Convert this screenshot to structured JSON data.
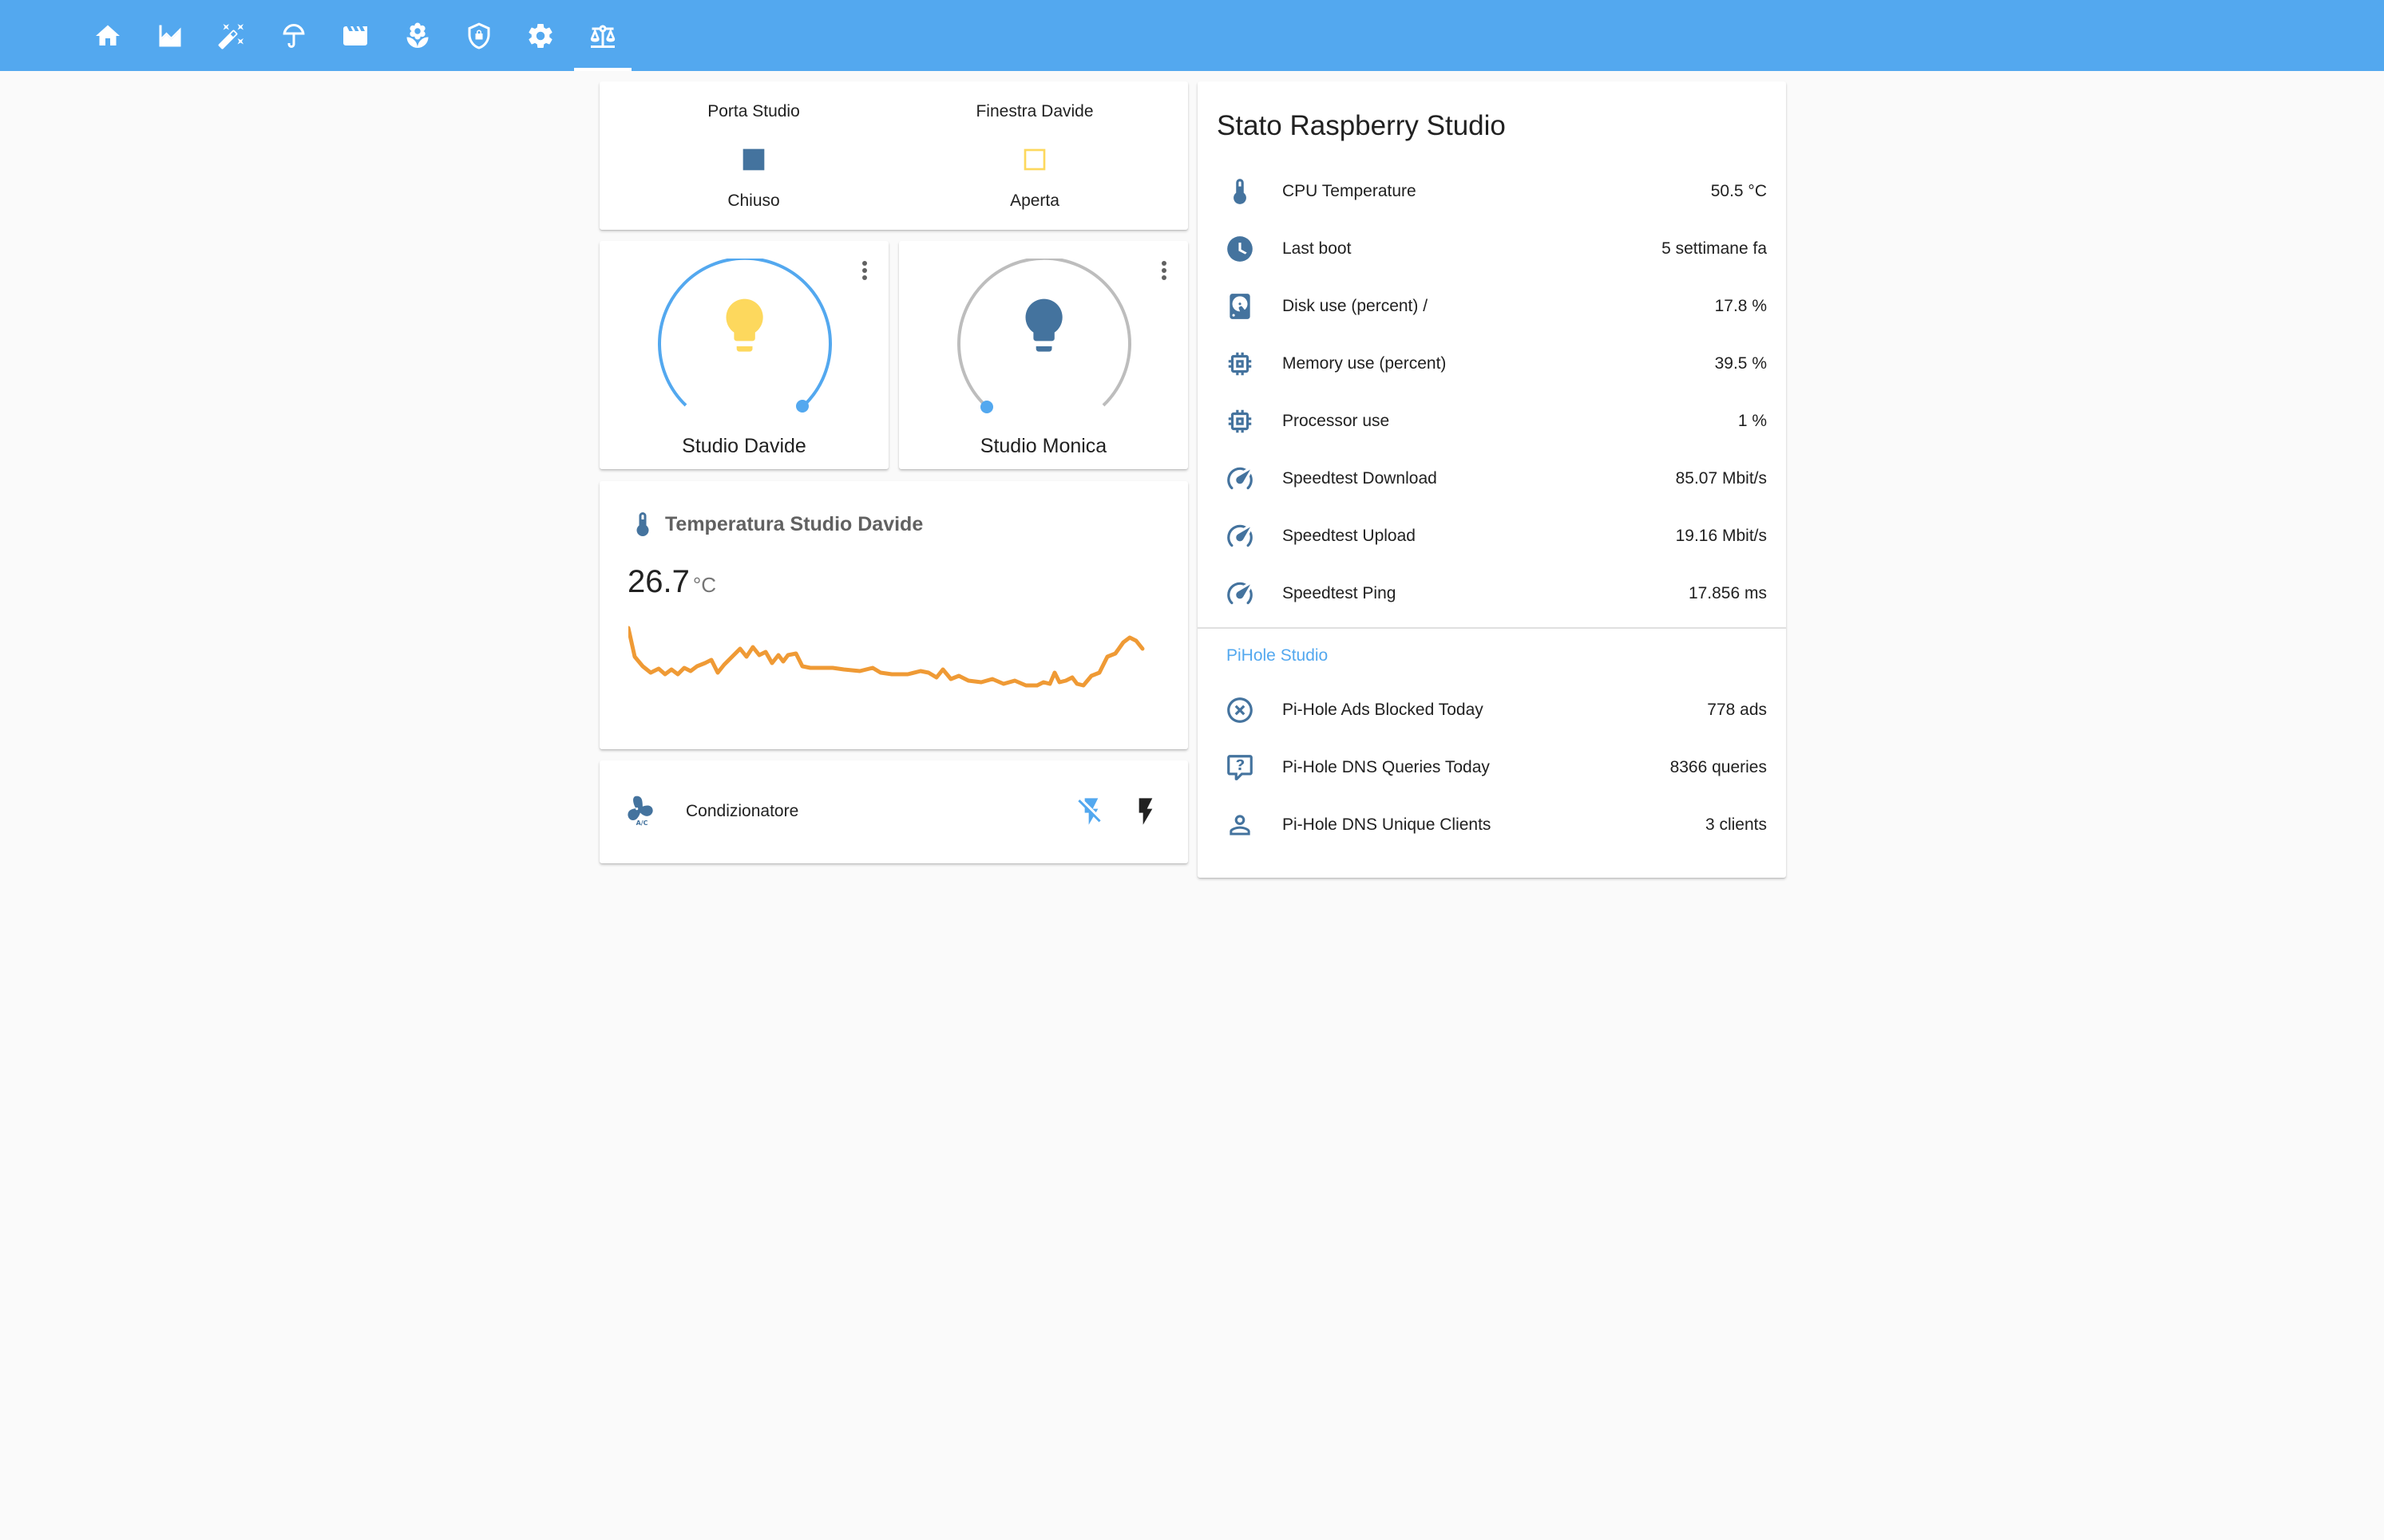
{
  "colors": {
    "header": "#53a8ef",
    "icon_primary": "#44739e",
    "light_on": "#fdd85d",
    "light_off": "#44739e",
    "graph_line": "#ef9a35",
    "accent": "#53a8ef"
  },
  "tabs": [
    {
      "icon": "home-icon"
    },
    {
      "icon": "chart-areaspline-icon"
    },
    {
      "icon": "auto-fix-icon"
    },
    {
      "icon": "umbrella-icon"
    },
    {
      "icon": "movie-icon"
    },
    {
      "icon": "flower-icon"
    },
    {
      "icon": "shield-lock-icon"
    },
    {
      "icon": "settings-icon"
    },
    {
      "icon": "scale-balance-icon",
      "active": true
    }
  ],
  "glance": [
    {
      "name": "Porta Studio",
      "state": "Chiuso",
      "icon": "square-filled-icon"
    },
    {
      "name": "Finestra Davide",
      "state": "Aperta",
      "icon": "square-outline-icon"
    }
  ],
  "lights": [
    {
      "name": "Studio Davide",
      "on": true,
      "icon": "lightbulb-icon",
      "brightness": 1.0
    },
    {
      "name": "Studio Monica",
      "on": false,
      "icon": "lightbulb-icon",
      "brightness": 0.0
    }
  ],
  "sensor": {
    "title": "Temperatura Studio Davide",
    "value": "26.7",
    "unit": "°C",
    "icon": "thermometer-icon"
  },
  "aircon": {
    "label": "Condizionatore",
    "icon": "air-conditioner-icon",
    "off_icon": "flash-off-icon",
    "on_icon": "flash-icon"
  },
  "raspberry": {
    "title": "Stato Raspberry Studio",
    "rows": [
      {
        "icon": "thermometer-icon",
        "label": "CPU Temperature",
        "value": "50.5 °C"
      },
      {
        "icon": "clock-icon",
        "label": "Last boot",
        "value": "5 settimane fa"
      },
      {
        "icon": "harddisk-icon",
        "label": "Disk use (percent) /",
        "value": "17.8 %"
      },
      {
        "icon": "memory-icon",
        "label": "Memory use (percent)",
        "value": "39.5 %"
      },
      {
        "icon": "memory-icon",
        "label": "Processor use",
        "value": "1 %"
      },
      {
        "icon": "speedometer-icon",
        "label": "Speedtest Download",
        "value": "85.07 Mbit/s"
      },
      {
        "icon": "speedometer-icon",
        "label": "Speedtest Upload",
        "value": "19.16 Mbit/s"
      },
      {
        "icon": "speedometer-icon",
        "label": "Speedtest Ping",
        "value": "17.856 ms"
      }
    ],
    "pihole_title": "PiHole Studio",
    "pihole_rows": [
      {
        "icon": "close-circle-outline-icon",
        "label": "Pi-Hole Ads Blocked Today",
        "value": "778 ads"
      },
      {
        "icon": "comment-question-outline-icon",
        "label": "Pi-Hole DNS Queries Today",
        "value": "8366 queries"
      },
      {
        "icon": "account-outline-icon",
        "label": "Pi-Hole DNS Unique Clients",
        "value": "3 clients"
      }
    ]
  }
}
